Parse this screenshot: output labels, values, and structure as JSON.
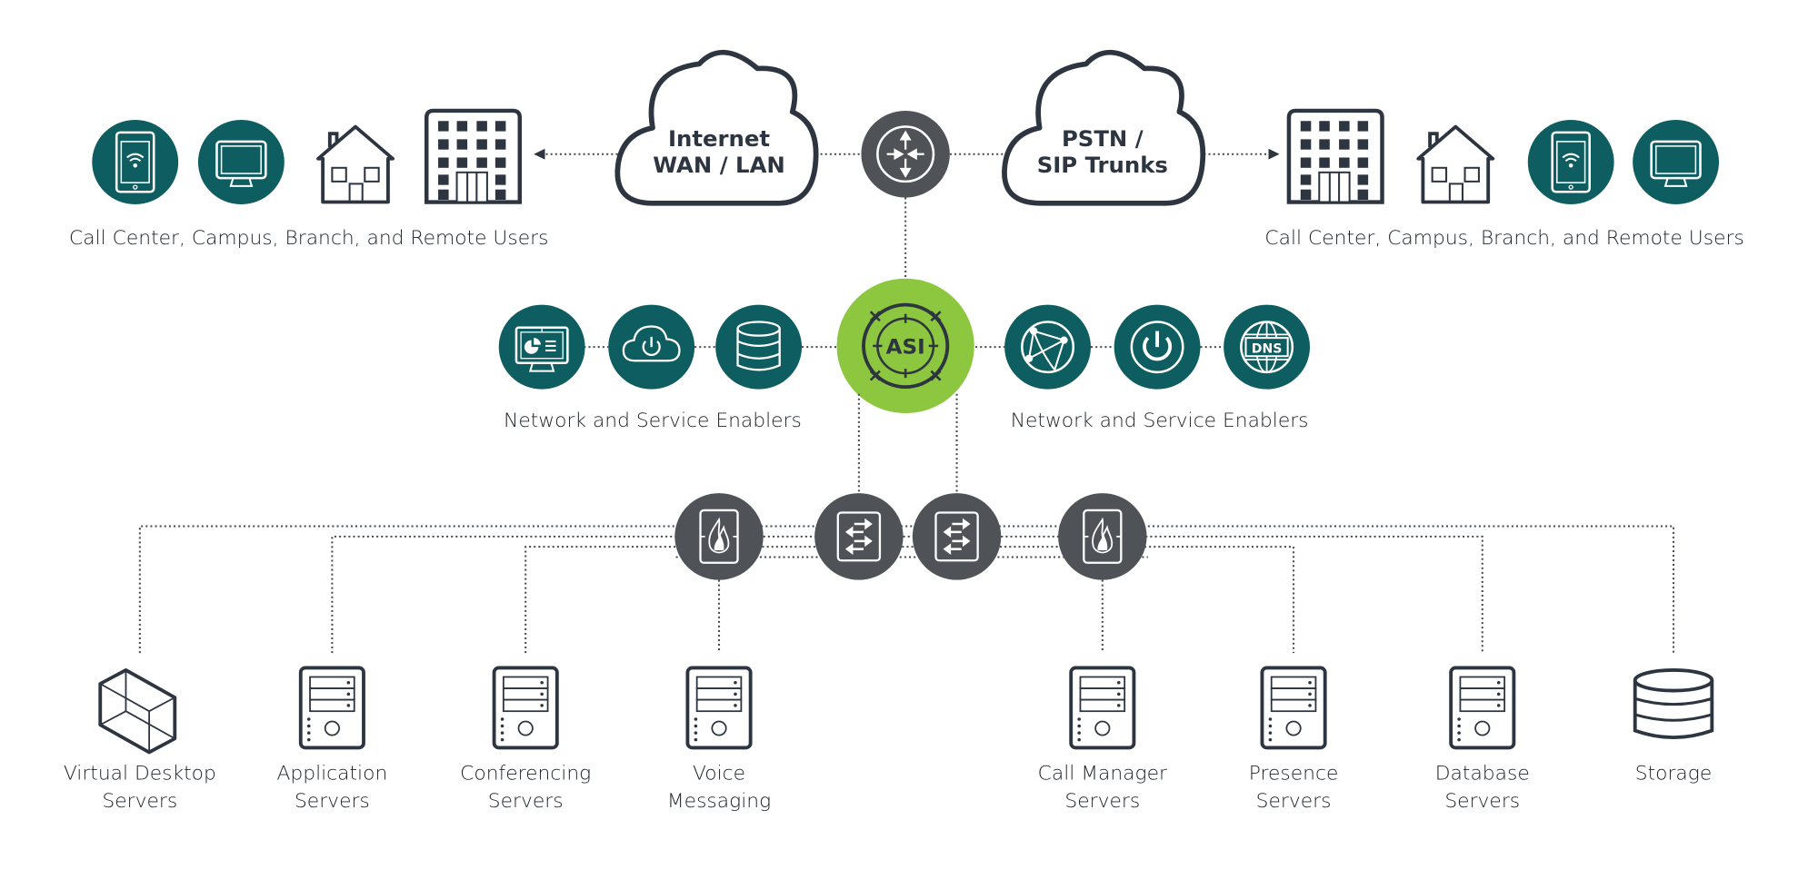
{
  "colors": {
    "teal": "#0e5d60",
    "gray": "#4f5257",
    "green": "#8dc63f",
    "ink": "#2d3540"
  },
  "top": {
    "left_group_label": "Call Center, Campus, Branch, and Remote Users",
    "right_group_label": "Call Center, Campus, Branch, and Remote Users",
    "cloud_internet": {
      "line1": "Internet",
      "line2": "WAN / LAN"
    },
    "cloud_pstn": {
      "line1": "PSTN /",
      "line2": "SIP Trunks"
    },
    "router_icon": "router-icon",
    "user_icons": [
      "tablet-wifi-icon",
      "monitor-icon",
      "house-icon",
      "office-building-icon"
    ]
  },
  "middle": {
    "center_label": "ASI",
    "left_enablers_label": "Network and Service Enablers",
    "right_enablers_label": "Network and Service Enablers",
    "left_enabler_icons": [
      "dashboard-monitor-icon",
      "cloud-power-icon",
      "database-icon"
    ],
    "right_enabler_icons": [
      "globe-network-icon",
      "power-icon",
      "dns-globe-icon"
    ],
    "dns_text": "DNS"
  },
  "switching": {
    "nodes": [
      "firewall-icon",
      "switch-icon",
      "switch-icon",
      "firewall-icon"
    ]
  },
  "servers": [
    {
      "line1": "Virtual Desktop",
      "line2": "Servers",
      "icon": "virtual-cube-icon"
    },
    {
      "line1": "Application",
      "line2": "Servers",
      "icon": "server-tower-icon"
    },
    {
      "line1": "Conferencing",
      "line2": "Servers",
      "icon": "server-tower-icon"
    },
    {
      "line1": "Voice",
      "line2": "Messaging",
      "icon": "server-tower-icon"
    },
    {
      "line1": "Call Manager",
      "line2": "Servers",
      "icon": "server-tower-icon"
    },
    {
      "line1": "Presence",
      "line2": "Servers",
      "icon": "server-tower-icon"
    },
    {
      "line1": "Database",
      "line2": "Servers",
      "icon": "server-tower-icon"
    },
    {
      "line1": "Storage",
      "line2": "",
      "icon": "storage-disks-icon"
    }
  ]
}
